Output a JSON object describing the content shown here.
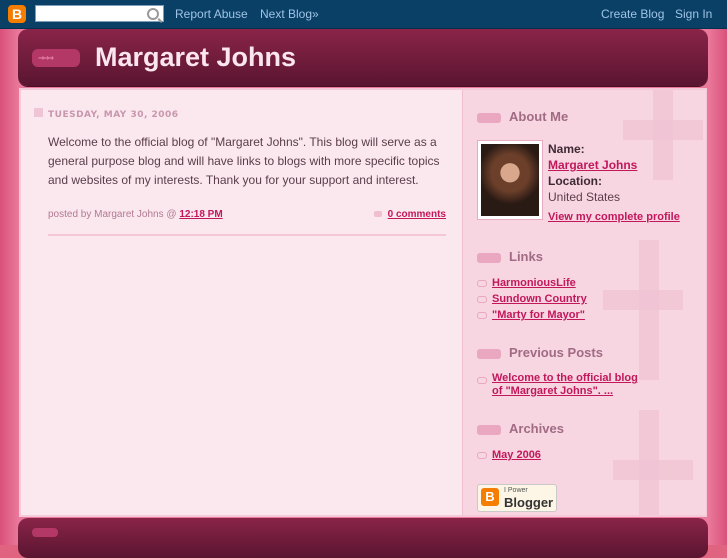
{
  "navbar": {
    "search_placeholder": "",
    "report_abuse": "Report Abuse",
    "next_blog": "Next Blog»",
    "create_blog": "Create Blog",
    "sign_in": "Sign In",
    "logo_letter": "B"
  },
  "header": {
    "title": "Margaret Johns",
    "arrow_glyph": "→→→"
  },
  "post": {
    "date": "TUESDAY, MAY 30, 2006",
    "body": "Welcome to the official blog of \"Margaret Johns\". This blog will serve as a general purpose blog and will have links to blogs with more specific topics and websites of my interests. Thank you for your support and interest.",
    "posted_by": "posted by Margaret Johns @ ",
    "time": "12:18 PM",
    "comments": "0 comments"
  },
  "sidebar": {
    "about": {
      "heading": "About Me",
      "name_label": "Name:",
      "name_value": "Margaret Johns",
      "location_label": "Location:",
      "location_value": "United States",
      "profile_link": "View my complete profile"
    },
    "links": {
      "heading": "Links",
      "items": [
        "HarmoniousLife",
        "Sundown Country",
        "\"Marty for Mayor\""
      ]
    },
    "previous": {
      "heading": "Previous Posts",
      "items": [
        "Welcome to the official blog of \"Margaret Johns\". ..."
      ]
    },
    "archives": {
      "heading": "Archives",
      "items": [
        "May 2006"
      ]
    },
    "badge": {
      "letter": "B",
      "small": "I Power",
      "big": "Blogger"
    }
  },
  "colors": {
    "navbar": "#0a3f66",
    "header": "#6e1b3a",
    "link": "#c2185b",
    "page_bg": "#e9789a"
  }
}
